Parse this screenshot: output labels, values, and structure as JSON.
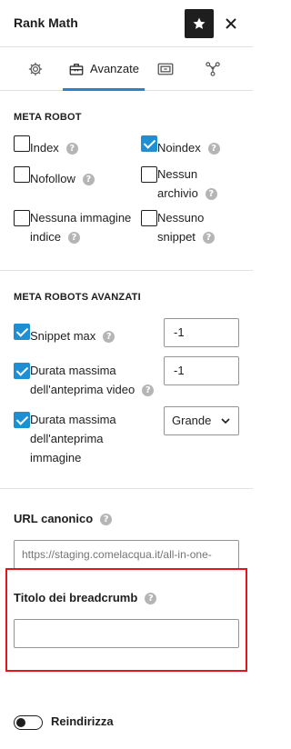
{
  "header": {
    "title": "Rank Math"
  },
  "tabs": [
    {
      "name": "general",
      "icon": "gear-icon",
      "label": ""
    },
    {
      "name": "advanced",
      "icon": "toolbox-icon",
      "label": "Avanzate"
    },
    {
      "name": "schema",
      "icon": "schema-icon",
      "label": ""
    },
    {
      "name": "social",
      "icon": "share-nodes-icon",
      "label": ""
    }
  ],
  "meta_robot": {
    "title": "META ROBOT",
    "options": [
      {
        "label": "Index",
        "checked": false
      },
      {
        "label": "Noindex",
        "checked": true
      },
      {
        "label": "Nofollow",
        "checked": false
      },
      {
        "label_line1": "Nessun",
        "label_line2": "archivio",
        "checked": false
      },
      {
        "label_line1": "Nessuna immagine",
        "label_line2": "indice",
        "checked": false
      },
      {
        "label_line1": "Nessuno",
        "label_line2": "snippet",
        "checked": false
      }
    ]
  },
  "advanced_robots": {
    "title": "META ROBOTS AVANZATI",
    "snippet_max": {
      "label": "Snippet max",
      "checked": true,
      "value": "-1"
    },
    "video_preview": {
      "label_line1": "Durata massima",
      "label_line2": "dell'anteprima video",
      "checked": true,
      "value": "-1"
    },
    "image_preview": {
      "label_line1": "Durata massima",
      "label_line2": "dell'anteprima",
      "label_line3": "immagine",
      "checked": true,
      "value": "Grande"
    }
  },
  "canonical": {
    "label": "URL canonico",
    "placeholder": "https://staging.comelacqua.it/all-in-one-"
  },
  "breadcrumb": {
    "label": "Titolo dei breadcrumb",
    "value": ""
  },
  "redirect": {
    "label": "Reindirizza",
    "enabled": false
  },
  "colors": {
    "accent": "#2b84c7",
    "checkbox": "#1d8fd2",
    "highlight": "#e4141b"
  },
  "help_glyph": "?"
}
